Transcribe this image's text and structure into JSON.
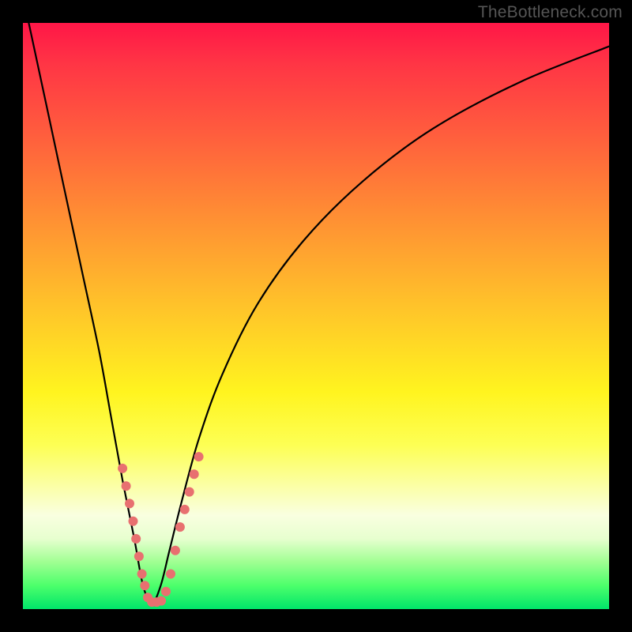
{
  "watermark": "TheBottleneck.com",
  "chart_data": {
    "type": "line",
    "title": "",
    "xlabel": "",
    "ylabel": "",
    "xlim": [
      0,
      100
    ],
    "ylim": [
      0,
      100
    ],
    "grid": false,
    "legend": false,
    "background_gradient": {
      "top": "#ff1647",
      "mid": "#fff41f",
      "bottom": "#00e56a",
      "meaning_top": "high bottleneck",
      "meaning_bottom": "no bottleneck"
    },
    "series": [
      {
        "name": "bottleneck-curve",
        "color": "#000000",
        "x": [
          1,
          4,
          7,
          10,
          13,
          15,
          17,
          19,
          20.5,
          22,
          23.5,
          25,
          27,
          30,
          34,
          40,
          48,
          58,
          70,
          85,
          100
        ],
        "values": [
          100,
          86,
          72,
          58,
          44,
          33,
          22,
          12,
          4,
          1,
          4,
          10,
          18,
          29,
          40,
          52,
          63,
          73,
          82,
          90,
          96
        ]
      }
    ],
    "markers": [
      {
        "name": "data-points-left-branch",
        "color": "#e87070",
        "radius": 6,
        "points": [
          {
            "x": 17.0,
            "y": 24
          },
          {
            "x": 17.6,
            "y": 21
          },
          {
            "x": 18.2,
            "y": 18
          },
          {
            "x": 18.8,
            "y": 15
          },
          {
            "x": 19.3,
            "y": 12
          },
          {
            "x": 19.8,
            "y": 9
          },
          {
            "x": 20.3,
            "y": 6
          },
          {
            "x": 20.8,
            "y": 4
          },
          {
            "x": 21.3,
            "y": 2
          }
        ]
      },
      {
        "name": "data-points-bottom",
        "color": "#e87070",
        "radius": 6,
        "points": [
          {
            "x": 22.0,
            "y": 1.2
          },
          {
            "x": 22.8,
            "y": 1.2
          },
          {
            "x": 23.6,
            "y": 1.4
          }
        ]
      },
      {
        "name": "data-points-right-branch",
        "color": "#e87070",
        "radius": 6,
        "points": [
          {
            "x": 24.4,
            "y": 3
          },
          {
            "x": 25.2,
            "y": 6
          },
          {
            "x": 26.0,
            "y": 10
          },
          {
            "x": 26.8,
            "y": 14
          },
          {
            "x": 27.6,
            "y": 17
          },
          {
            "x": 28.4,
            "y": 20
          },
          {
            "x": 29.2,
            "y": 23
          },
          {
            "x": 30.0,
            "y": 26
          }
        ]
      }
    ]
  }
}
